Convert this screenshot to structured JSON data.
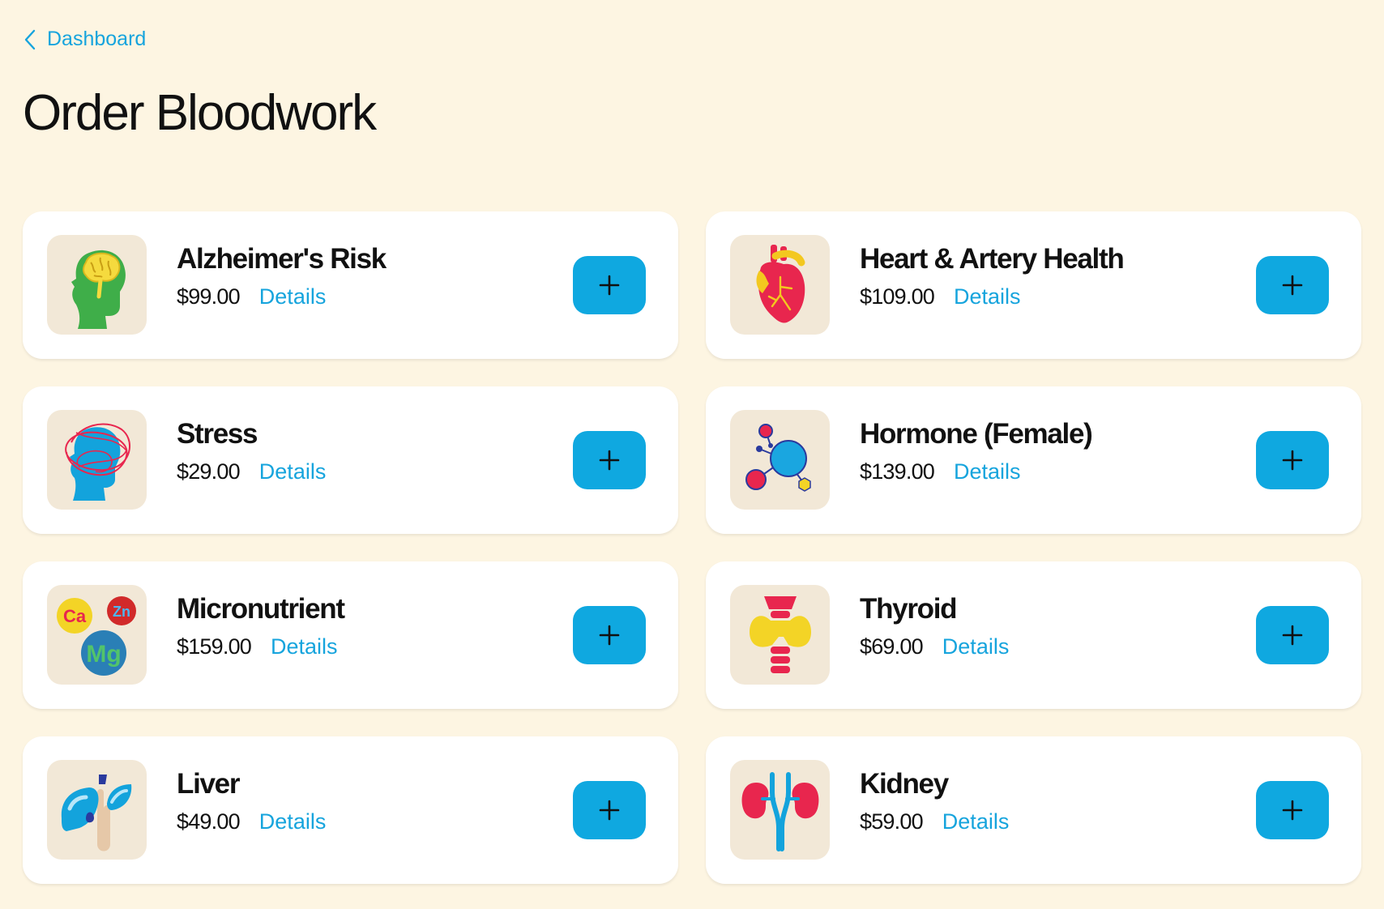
{
  "nav": {
    "back_label": "Dashboard"
  },
  "page": {
    "title": "Order Bloodwork"
  },
  "tests": [
    {
      "name": "Alzheimer's Risk",
      "price": "$99.00",
      "details_label": "Details",
      "icon": "brain-head-icon"
    },
    {
      "name": "Heart & Artery Health",
      "price": "$109.00",
      "details_label": "Details",
      "icon": "heart-icon"
    },
    {
      "name": "Stress",
      "price": "$29.00",
      "details_label": "Details",
      "icon": "stressed-head-icon"
    },
    {
      "name": "Hormone (Female)",
      "price": "$139.00",
      "details_label": "Details",
      "icon": "molecule-icon"
    },
    {
      "name": "Micronutrient",
      "price": "$159.00",
      "details_label": "Details",
      "icon": "minerals-icon"
    },
    {
      "name": "Thyroid",
      "price": "$69.00",
      "details_label": "Details",
      "icon": "thyroid-icon"
    },
    {
      "name": "Liver",
      "price": "$49.00",
      "details_label": "Details",
      "icon": "liver-icon"
    },
    {
      "name": "Kidney",
      "price": "$59.00",
      "details_label": "Details",
      "icon": "kidney-icon"
    }
  ],
  "minerals": {
    "calcium": "Ca",
    "zinc": "Zn",
    "magnesium": "Mg"
  },
  "colors": {
    "accent": "#16a4dd",
    "button": "#0fa8e0",
    "background": "#fdf5e2",
    "card": "#ffffff",
    "thumb": "#f2e8d7"
  }
}
